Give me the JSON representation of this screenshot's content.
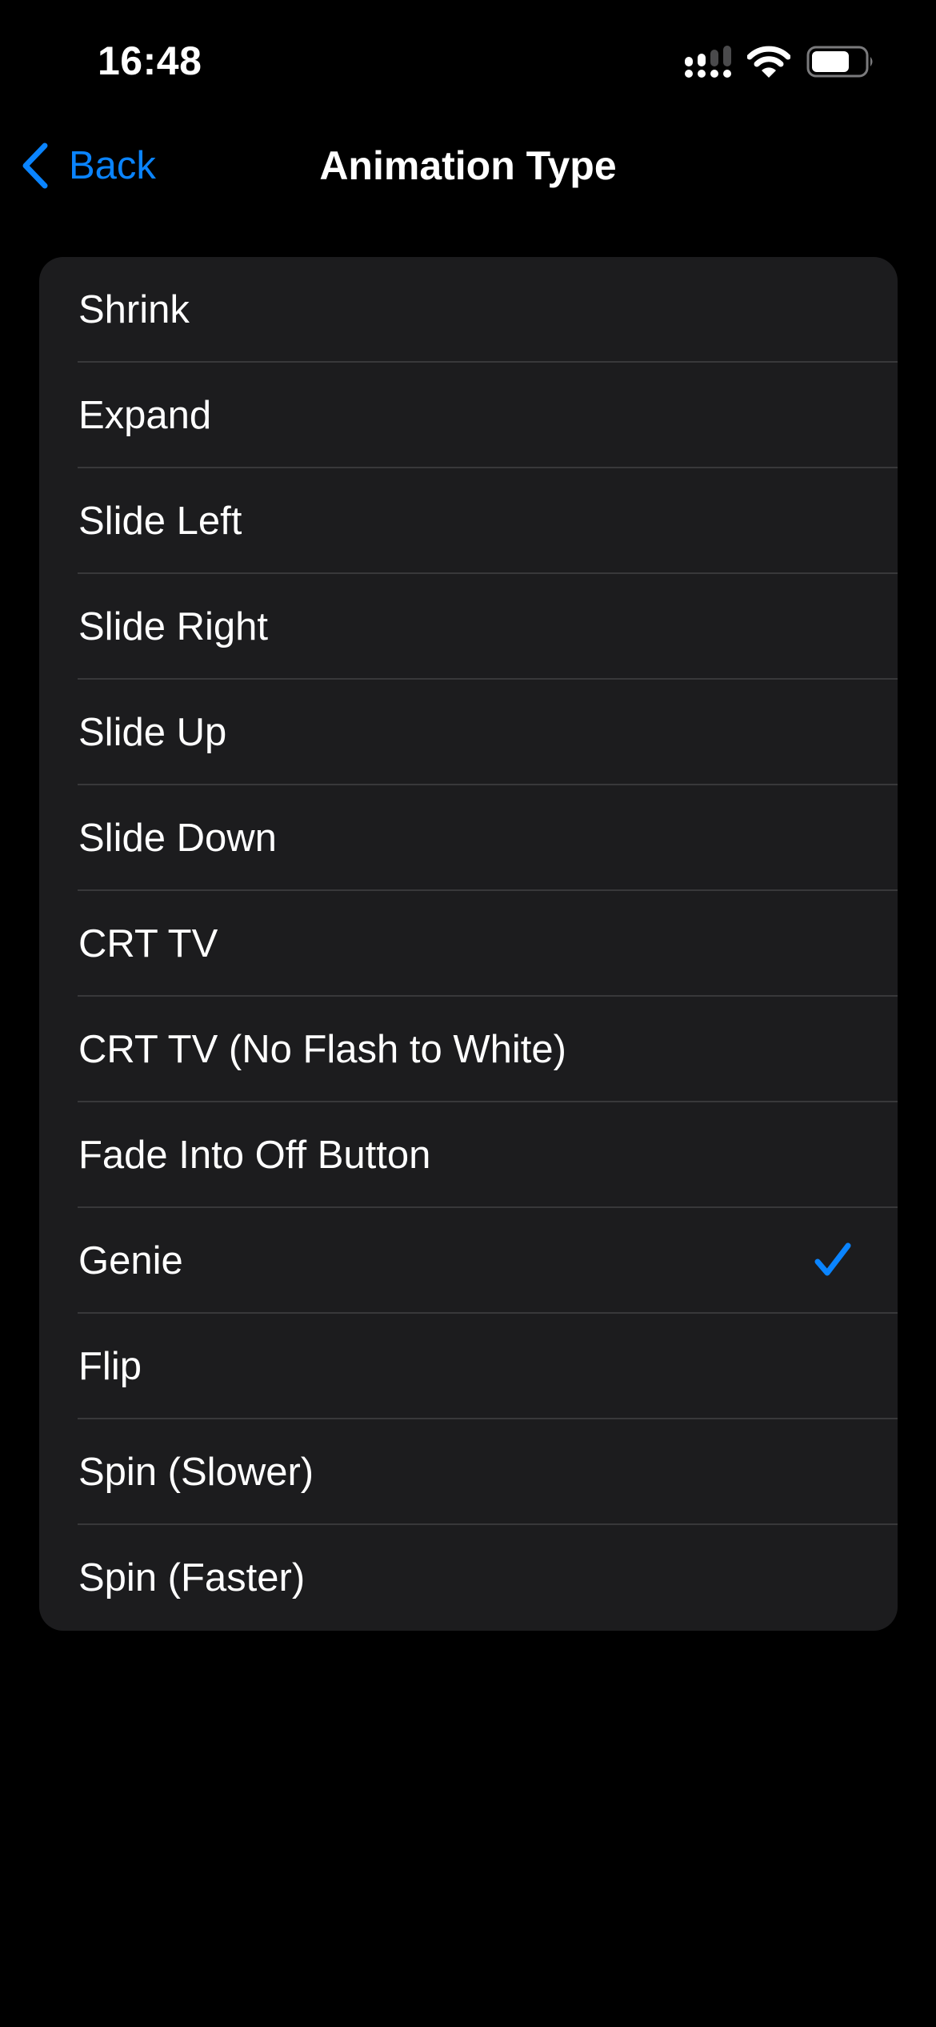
{
  "status_bar": {
    "time": "16:48",
    "signal_icon": "cellular-signal-icon",
    "signal_bars_active": 2,
    "signal_bars_total": 4,
    "wifi_icon": "wifi-icon",
    "battery_icon": "battery-icon",
    "battery_level_fraction": 0.7
  },
  "nav": {
    "back_label": "Back",
    "back_icon": "chevron-left-icon",
    "title": "Animation Type"
  },
  "colors": {
    "accent": "#0a84ff",
    "background": "#000000",
    "card": "#1c1c1e",
    "separator": "#38383a",
    "text": "#ffffff"
  },
  "options": [
    {
      "label": "Shrink",
      "selected": false
    },
    {
      "label": "Expand",
      "selected": false
    },
    {
      "label": "Slide Left",
      "selected": false
    },
    {
      "label": "Slide Right",
      "selected": false
    },
    {
      "label": "Slide Up",
      "selected": false
    },
    {
      "label": "Slide Down",
      "selected": false
    },
    {
      "label": "CRT TV",
      "selected": false
    },
    {
      "label": "CRT TV (No Flash to White)",
      "selected": false
    },
    {
      "label": "Fade Into Off Button",
      "selected": false
    },
    {
      "label": "Genie",
      "selected": true
    },
    {
      "label": "Flip",
      "selected": false
    },
    {
      "label": "Spin (Slower)",
      "selected": false
    },
    {
      "label": "Spin (Faster)",
      "selected": false
    }
  ],
  "selected_icon": "checkmark-icon"
}
